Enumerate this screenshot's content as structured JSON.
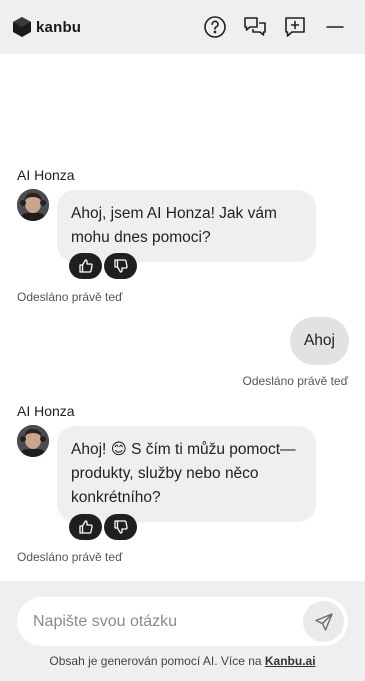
{
  "header": {
    "brand": "kanbu",
    "icons": [
      "help-icon",
      "conversations-icon",
      "new-chat-icon",
      "minimize-icon"
    ]
  },
  "messages": [
    {
      "role": "bot",
      "sender": "AI Honza",
      "text": "Ahoj, jsem AI Honza! Jak vám mohu dnes pomoci?",
      "status": "Odesláno právě teď"
    },
    {
      "role": "user",
      "text": "Ahoj",
      "status": "Odesláno právě teď"
    },
    {
      "role": "bot",
      "sender": "AI Honza",
      "text": "Ahoj! 😊 S čím ti můžu pomoct—produkty, služby nebo něco konkrétního?",
      "status": "Odesláno právě teď"
    }
  ],
  "composer": {
    "placeholder": "Napište svou otázku"
  },
  "footer": {
    "disclaimer_text": "Obsah je generován pomocí AI. Více na ",
    "disclaimer_link": "Kanbu.ai"
  },
  "colors": {
    "header_bg": "#efefef",
    "bot_bubble": "#efefef",
    "user_bubble": "#e2e2e2",
    "feedback_btn": "#1f1f1f"
  }
}
